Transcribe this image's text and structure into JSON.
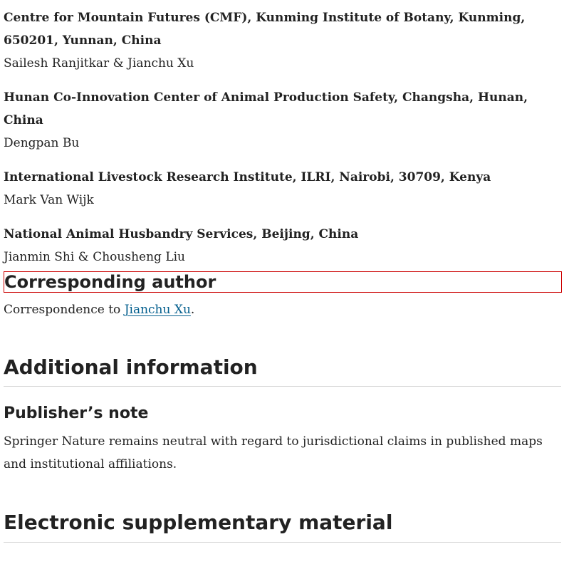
{
  "affiliations": [
    {
      "name": "Centre for Mountain Futures (CMF), Kunming Institute of Botany, Kunming, 650201, Yunnan, China",
      "authors": "Sailesh Ranjitkar & Jianchu Xu"
    },
    {
      "name": "Hunan Co-Innovation Center of Animal Production Safety, Changsha, Hunan, China",
      "authors": "Dengpan Bu"
    },
    {
      "name": "International Livestock Research Institute, ILRI, Nairobi, 30709, Kenya",
      "authors": "Mark Van Wijk"
    },
    {
      "name": "National Animal Husbandry Services, Beijing, China",
      "authors": "Jianmin Shi & Chousheng Liu"
    }
  ],
  "corresponding": {
    "heading": "Corresponding author",
    "prefix": "Correspondence to ",
    "link_text": "Jianchu Xu",
    "suffix": "."
  },
  "additional_info": {
    "heading": "Additional information",
    "publishers_note": {
      "heading": "Publisher’s note",
      "text": "Springer Nature remains neutral with regard to jurisdictional claims in published maps and institutional affiliations."
    }
  },
  "supplementary": {
    "heading": "Electronic supplementary material"
  },
  "colors": {
    "text": "#222222",
    "link": "#025e8d",
    "highlight_border": "#cc0000",
    "rule": "#d5d5d5"
  }
}
